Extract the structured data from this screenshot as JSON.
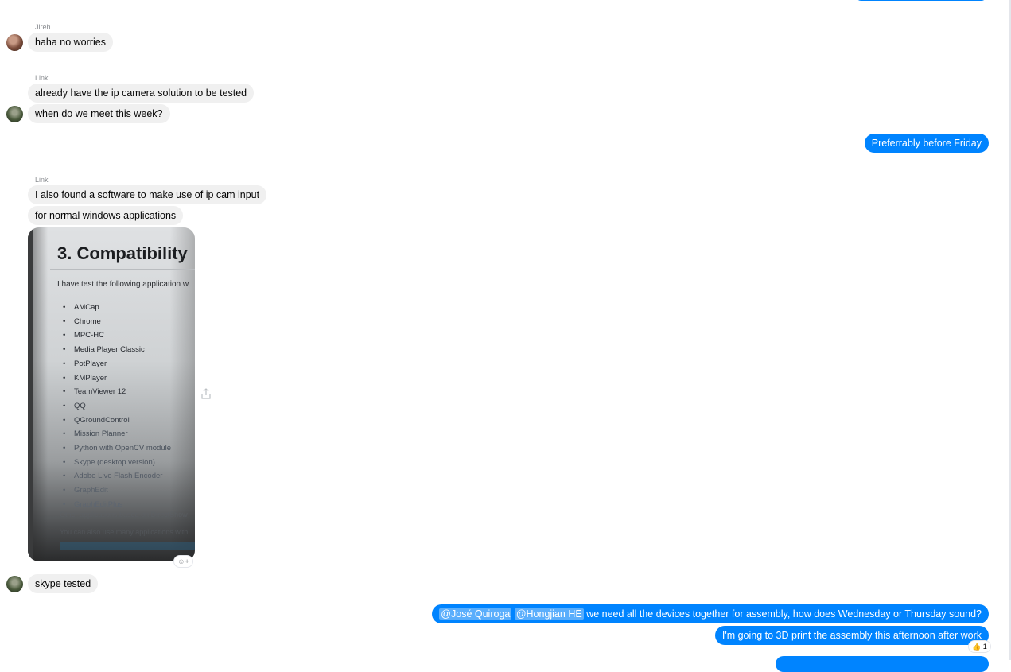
{
  "messages": {
    "m1": {
      "sender": "Jireh",
      "text": "haha no worries"
    },
    "m2": {
      "sender": "Link",
      "text": "already have the ip camera solution to be tested"
    },
    "m3": {
      "text": "when do we meet this week?"
    },
    "m4": {
      "text": "Preferrably before Friday"
    },
    "m5": {
      "sender": "Link",
      "text": "I also found a software to make use of ip cam input"
    },
    "m6": {
      "text": "for normal windows applications"
    },
    "m7": {
      "text": "skype tested"
    },
    "m8": {
      "mention1": "@José Quiroga",
      "mention2": "@Hongjian HE",
      "text": " we need all the devices together for assembly, how does Wednesday or Thursday sound?"
    },
    "m9": {
      "text": "I'm going to 3D print the assembly this afternoon after work",
      "reaction_emoji": "👍",
      "reaction_count": "1"
    }
  },
  "photo": {
    "heading": "3. Compatibility",
    "intro": "I have test the following application w",
    "items": [
      "AMCap",
      "Chrome",
      "MPC-HC",
      "Media Player Classic",
      "PotPlayer",
      "KMPlayer",
      "TeamViewer 12",
      "QQ",
      "QGroundControl",
      "Mission Planner",
      "Python with OpenCV module",
      "Skype (desktop version)",
      "Adobe Live Flash Encoder",
      "GraphEdit",
      "GraphEditPlus"
    ],
    "footer1": "Other applications based on DirectShow",
    "footer2": "You can also use many applications with"
  },
  "colors": {
    "outgoing": "#0084ff",
    "incoming": "#f0f0f0",
    "mention_highlight": "#5aaefc"
  },
  "icons": {
    "share": "share-icon",
    "add_reaction": "add-reaction-icon"
  }
}
